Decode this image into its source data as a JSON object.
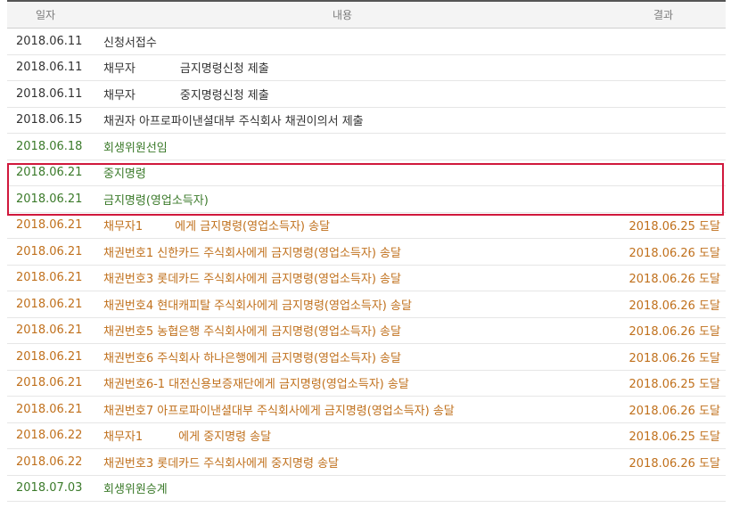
{
  "header": {
    "date": "일자",
    "content": "내용",
    "result": "결과"
  },
  "colors": {
    "dark": "#333333",
    "green": "#3b7a2a",
    "orange": "#c0701c",
    "highlight": "#d0183c"
  },
  "rows": [
    {
      "date": "2018.06.11",
      "content_a": "신청서접수",
      "content_b": "",
      "result": "",
      "color": "dark"
    },
    {
      "date": "2018.06.11",
      "content_a": "채무자",
      "content_b": "금지명령신청 제출",
      "result": "",
      "color": "dark"
    },
    {
      "date": "2018.06.11",
      "content_a": "채무자",
      "content_b": "중지명령신청 제출",
      "result": "",
      "color": "dark"
    },
    {
      "date": "2018.06.15",
      "content_a": "채권자 아프로파이낸셜대부 주식회사 채권이의서 제출",
      "content_b": "",
      "result": "",
      "color": "dark"
    },
    {
      "date": "2018.06.18",
      "content_a": "회생위원선임",
      "content_b": "",
      "result": "",
      "color": "green"
    },
    {
      "date": "2018.06.21",
      "content_a": "중지명령",
      "content_b": "",
      "result": "",
      "color": "green"
    },
    {
      "date": "2018.06.21",
      "content_a": "금지명령(영업소득자)",
      "content_b": "",
      "result": "",
      "color": "green"
    },
    {
      "date": "2018.06.21",
      "content_a": "채무자1",
      "content_b": "에게 금지명령(영업소득자) 송달",
      "result": "2018.06.25 도달",
      "color": "orange"
    },
    {
      "date": "2018.06.21",
      "content_a": "채권번호1 신한카드 주식회사에게 금지명령(영업소득자) 송달",
      "content_b": "",
      "result": "2018.06.26 도달",
      "color": "orange"
    },
    {
      "date": "2018.06.21",
      "content_a": "채권번호3 롯데카드 주식회사에게 금지명령(영업소득자) 송달",
      "content_b": "",
      "result": "2018.06.26 도달",
      "color": "orange"
    },
    {
      "date": "2018.06.21",
      "content_a": "채권번호4 현대캐피탈 주식회사에게 금지명령(영업소득자) 송달",
      "content_b": "",
      "result": "2018.06.26 도달",
      "color": "orange"
    },
    {
      "date": "2018.06.21",
      "content_a": "채권번호5 농협은행 주식회사에게 금지명령(영업소득자) 송달",
      "content_b": "",
      "result": "2018.06.26 도달",
      "color": "orange"
    },
    {
      "date": "2018.06.21",
      "content_a": "채권번호6 주식회사 하나은행에게 금지명령(영업소득자) 송달",
      "content_b": "",
      "result": "2018.06.26 도달",
      "color": "orange"
    },
    {
      "date": "2018.06.21",
      "content_a": "채권번호6-1 대전신용보증재단에게 금지명령(영업소득자) 송달",
      "content_b": "",
      "result": "2018.06.25 도달",
      "color": "orange"
    },
    {
      "date": "2018.06.21",
      "content_a": "채권번호7 아프로파이낸셜대부 주식회사에게 금지명령(영업소득자) 송달",
      "content_b": "",
      "result": "2018.06.26 도달",
      "color": "orange"
    },
    {
      "date": "2018.06.22",
      "content_a": "채무자1",
      "content_b": "에게 중지명령 송달",
      "result": "2018.06.25 도달",
      "color": "orange"
    },
    {
      "date": "2018.06.22",
      "content_a": "채권번호3 롯데카드 주식회사에게 중지명령 송달",
      "content_b": "",
      "result": "2018.06.26 도달",
      "color": "orange"
    },
    {
      "date": "2018.07.03",
      "content_a": "회생위원승계",
      "content_b": "",
      "result": "",
      "color": "green"
    }
  ]
}
